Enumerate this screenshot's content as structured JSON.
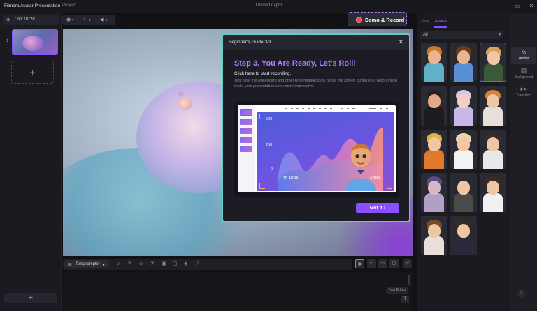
{
  "titlebar": {
    "app_title": "Filmora Avatar Presentation",
    "menu_project": "Project",
    "file_name": "Untitled.dapro",
    "min_icon": "–",
    "max_icon": "▭",
    "close_icon": "✕"
  },
  "left_panel": {
    "clip_label": "Clip: 01:28",
    "slide_number": "1",
    "add_symbol": "+"
  },
  "toolbar": {
    "demo_record_label": "Demo & Record"
  },
  "right_panel": {
    "tabs": [
      "Ultra",
      "Avatar"
    ],
    "active_tab": "Avatar",
    "filter_value": "All",
    "side_nav": [
      {
        "label": "Avatar",
        "icon": "avatar-icon"
      },
      {
        "label": "Background",
        "icon": "background-icon"
      },
      {
        "label": "Transition",
        "icon": "transition-icon"
      }
    ],
    "avatars": [
      {
        "skin": "#e9b48e",
        "hair": "#c77b2a",
        "top": "#5fb0c9"
      },
      {
        "skin": "#e9b48e",
        "hair": "#6a3a1a",
        "top": "#5a8fd6"
      },
      {
        "skin": "#f0c7a5",
        "hair": "#d9a35a",
        "top": "#3a5a3a"
      },
      {
        "skin": "#e2a988",
        "hair": "#2a2020",
        "top": "#1c1c1c"
      },
      {
        "skin": "#f2d0c5",
        "hair": "#d9c7e6",
        "top": "#c9b8e6"
      },
      {
        "skin": "#f0c7a5",
        "hair": "#d8823a",
        "top": "#e6e0d8"
      },
      {
        "skin": "#f0c7a5",
        "hair": "#e0b040",
        "top": "#e07a2a"
      },
      {
        "skin": "#f0c7a5",
        "hair": "#e8d6a8",
        "top": "#f2f2f2"
      },
      {
        "skin": "#f0c7a5",
        "hair": "#3a2a2a",
        "top": "#e8e8e8"
      },
      {
        "skin": "#d7b7c8",
        "hair": "#5a4a8a",
        "top": "#b0a0c8"
      },
      {
        "skin": "#f0c7a5",
        "hair": "#2a2a2a",
        "top": "#4a4a4a"
      },
      {
        "skin": "#f0c7a5",
        "hair": "#3a2a20",
        "top": "#f0f0f0"
      },
      {
        "skin": "#f0c7a5",
        "hair": "#7a4a2a",
        "top": "#e8e0d8"
      },
      {
        "skin": "#f0c7a5",
        "hair": "#3a2a20",
        "top": "#2a2a3a"
      }
    ]
  },
  "bottom_bar": {
    "teleprompter_label": "Teleprompter",
    "text_editor_label": "Text Editor"
  },
  "modal": {
    "header_title": "Beginner's Guide 3/3",
    "close_symbol": "✕",
    "step_title": "Step 3. You Are Ready, Let's Roll!",
    "click_here": "Click here to start recording.",
    "tips": "Tips: Use the whiteboard and other presentation tools below the screen during your recording to make your presentation even more impressive.",
    "button_label": "Got it !",
    "preview_chart": {
      "y_ticks": [
        "500",
        "250",
        "0"
      ],
      "x_labels": [
        "15 APRIL",
        "APRIL"
      ]
    }
  },
  "colors": {
    "accent": "#8a4fff",
    "modal_border": "#5ad1c0",
    "record_red": "#ff3b4b"
  }
}
